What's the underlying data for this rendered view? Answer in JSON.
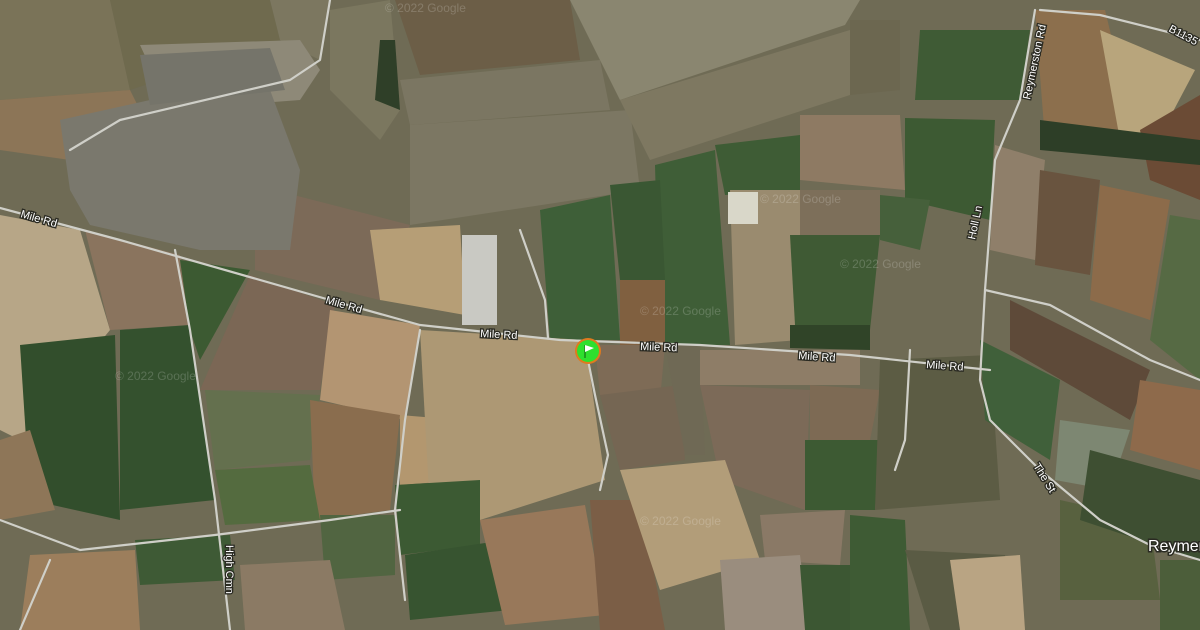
{
  "map": {
    "view": "satellite",
    "watermark": "© 2022 Google",
    "road_labels": {
      "mile_rd_west": "Mile Rd",
      "mile_rd_mid": "Mile Rd",
      "mile_rd_centre": "Mile Rd",
      "mile_rd_east1": "Mile Rd",
      "mile_rd_east2": "Mile Rd",
      "mile_rd_east3": "Mile Rd",
      "reymerston_rd": "Reymerston Rd",
      "holl_ln": "Holl Ln",
      "high_cmn": "High Cmn",
      "the_st": "The St",
      "b1135": "B1135"
    },
    "place_label": "Reymerston",
    "marker": {
      "name": "location-pin",
      "color": "#2ee02e",
      "ring_color": "#e07a1e"
    }
  }
}
